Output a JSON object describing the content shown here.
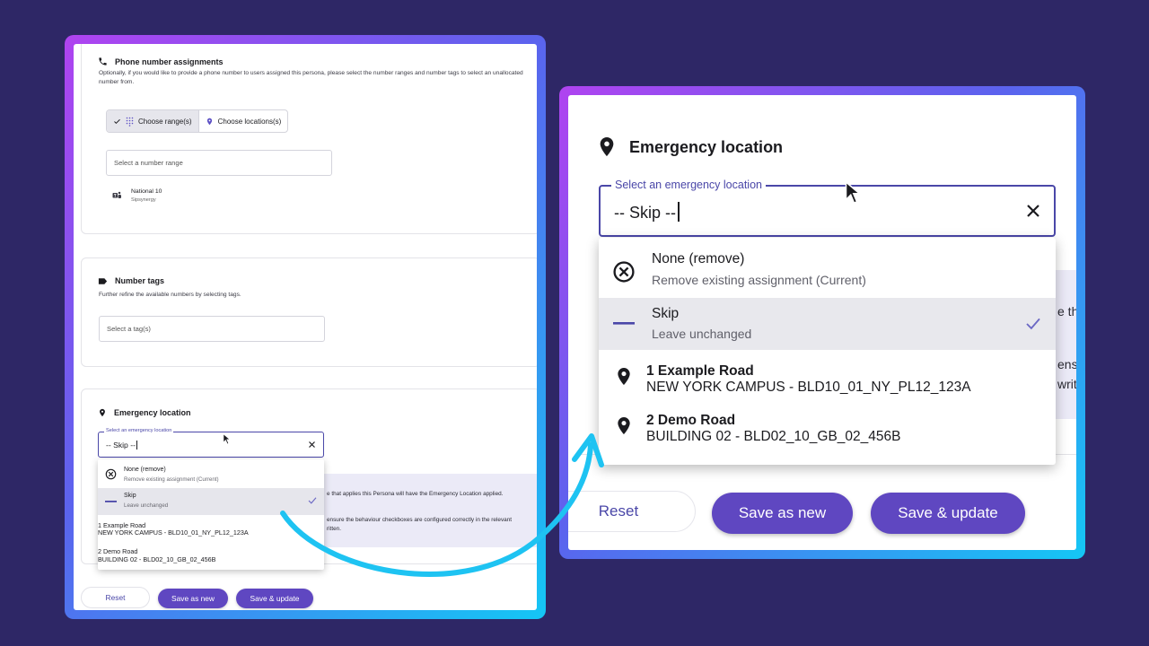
{
  "left": {
    "phone": {
      "title": "Phone number assignments",
      "description": "Optionally, if you would like to provide a phone number to users assigned this persona, please select the number ranges and number tags to select an unallocated number from.",
      "toggle_ranges": "Choose range(s)",
      "toggle_locations": "Choose locations(s)",
      "range_placeholder": "Select a number range",
      "range_item_name": "National 10",
      "range_item_provider": "Sipsynergy"
    },
    "tags": {
      "title": "Number tags",
      "description": "Further refine the available numbers by selecting tags.",
      "placeholder": "Select a tag(s)"
    },
    "emergency": {
      "title": "Emergency location",
      "select_label": "Select an emergency location",
      "value": "-- Skip --",
      "options": [
        {
          "title": "None (remove)",
          "subtitle": "Remove existing assignment (Current)"
        },
        {
          "title": "Skip",
          "subtitle": "Leave unchanged"
        },
        {
          "title": "1 Example Road",
          "subtitle": "NEW YORK CAMPUS - BLD10_01_NY_PL12_123A"
        },
        {
          "title": "2 Demo Road",
          "subtitle": "BUILDING 02 - BLD02_10_GB_02_456B"
        }
      ],
      "info_line1": "e that applies this Persona will have the Emergency Location applied.",
      "info_line2": "ensure the behaviour checkboxes are configured correctly in the relevant",
      "info_line3": "ritten."
    },
    "buttons": {
      "reset": "Reset",
      "save_new": "Save as new",
      "save_update": "Save & update"
    }
  },
  "right": {
    "title": "Emergency location",
    "select_label": "Select an emergency location",
    "value": "-- Skip --",
    "options": [
      {
        "title": "None (remove)",
        "subtitle": "Remove existing assignment (Current)"
      },
      {
        "title": "Skip",
        "subtitle": "Leave unchanged"
      },
      {
        "title": "1 Example Road",
        "subtitle": "NEW YORK CAMPUS - BLD10_01_NY_PL12_123A"
      },
      {
        "title": "2 Demo Road",
        "subtitle": "BUILDING 02 - BLD02_10_GB_02_456B"
      }
    ],
    "info_line1": "e tha",
    "info_line2": "ensu",
    "info_line3": "writte",
    "buttons": {
      "reset": "Reset",
      "save_new": "Save as new",
      "save_update": "Save & update"
    }
  },
  "colors": {
    "background": "#2e2766",
    "accent": "#4a47a8",
    "button_primary": "#5f47c1",
    "frame_gradient_start": "#b043f0",
    "frame_gradient_end": "#14c7f5",
    "arrow": "#1ec3f2"
  },
  "icons": [
    "phone-icon",
    "check-icon",
    "dialpad-icon",
    "location-pin-icon",
    "teams-icon",
    "tag-icon",
    "close-icon",
    "remove-circle-icon",
    "dash-icon",
    "mouse-pointer-icon",
    "curved-arrow"
  ]
}
